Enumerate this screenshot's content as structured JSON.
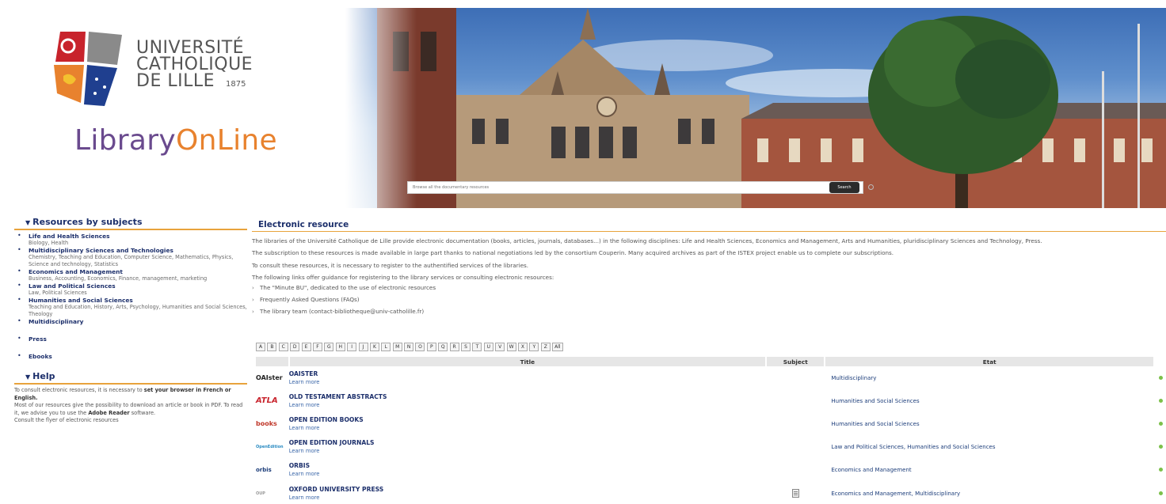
{
  "header": {
    "university_lines": [
      "UNIVERSITÉ",
      "CATHOLIQUE",
      "DE LILLE"
    ],
    "university_year": "1875",
    "library_title_part1": "Library",
    "library_title_part2": "OnLine"
  },
  "search": {
    "placeholder": "Browse all the documentary resources",
    "button_label": "Search"
  },
  "sidebar": {
    "subjects_heading": "Resources by subjects",
    "subjects": [
      {
        "title": "Life and Health Sciences",
        "desc": "Biology, Health"
      },
      {
        "title": "Multidisciplinary Sciences and Technologies",
        "desc": "Chemistry, Teaching and Education, Computer Science, Mathematics, Physics, Science and technology, Statistics"
      },
      {
        "title": "Economics and Management",
        "desc": "Business, Accounting, Economics, Finance, management, marketing"
      },
      {
        "title": "Law and Political Sciences",
        "desc": "Law, Political Sciences"
      },
      {
        "title": "Humanities and Social Sciences",
        "desc": "Teaching and Education, History, Arts, Psychology, Humanities and Social Sciences, Theology"
      },
      {
        "title": "Multidisciplinary",
        "desc": ""
      },
      {
        "title": "Press",
        "desc": ""
      },
      {
        "title": "Ebooks",
        "desc": ""
      }
    ],
    "help_heading": "Help",
    "help": {
      "p1_pre": "To consult electronic resources, it is necessary to ",
      "p1_bold": "set your browser in French or English.",
      "p2_pre": "Most of our resources give the possibility to download an article or book in PDF. To read it, we advise you to use the ",
      "p2_bold": "Adobe Reader",
      "p2_post": " software.",
      "p3": "Consult the flyer of electronic resources"
    }
  },
  "main": {
    "heading": "Electronic resource",
    "paragraphs": [
      "The libraries of the Université Catholique de Lille provide electronic documentation (books, articles, journals, databases...) in the following disciplines: Life and Health Sciences, Economics and Management, Arts and Humanities, pluridisciplinary Sciences and Technology, Press.",
      "The subscription to these resources is made available in large part thanks to national negotiations led by the consortium Couperin. Many acquired archives as part of the ISTEX project enable us to complete our subscriptions.",
      "To consult these resources, it is necessary to register to the authentified services of the libraries.",
      "The following links offer guidance for registering to the library services or consulting electronic resources:"
    ],
    "links": [
      "The \"Minute BU\", dedicated to the use of electronic resources",
      "Frequently Asked Questions (FAQs)",
      "The library team (contact-bibliotheque@univ-catholille.fr)"
    ]
  },
  "alphabet": [
    "A",
    "B",
    "C",
    "D",
    "E",
    "F",
    "G",
    "H",
    "I",
    "J",
    "K",
    "L",
    "M",
    "N",
    "O",
    "P",
    "Q",
    "R",
    "S",
    "T",
    "U",
    "V",
    "W",
    "X",
    "Y",
    "Z",
    "All"
  ],
  "table": {
    "headers": {
      "title": "Title",
      "subject": "Subject",
      "etat": "Etat"
    },
    "learn_more": "Learn more",
    "rows": [
      {
        "logo": "OAIster",
        "title": "OAISTER",
        "etat": "Multidisciplinary"
      },
      {
        "logo": "ATLA",
        "title": "OLD TESTAMENT ABSTRACTS",
        "etat": "Humanities and Social Sciences"
      },
      {
        "logo": "books",
        "title": "OPEN EDITION BOOKS",
        "etat": "Humanities and Social Sciences"
      },
      {
        "logo": "OpenEdition",
        "title": "OPEN EDITION JOURNALS",
        "etat": "Law and Political Sciences, Humanities and Social Sciences"
      },
      {
        "logo": "orbis",
        "title": "ORBIS",
        "etat": "Economics and Management"
      },
      {
        "logo": "OUP",
        "title": "OXFORD UNIVERSITY PRESS",
        "etat": "Economics and Management, Multidisciplinary"
      }
    ]
  },
  "colors": {
    "navy": "#1c2f6b",
    "accent_orange": "#e8a33c",
    "link_blue": "#3a66a8",
    "status_green": "#7cc04a",
    "purple": "#6a4a8e"
  }
}
